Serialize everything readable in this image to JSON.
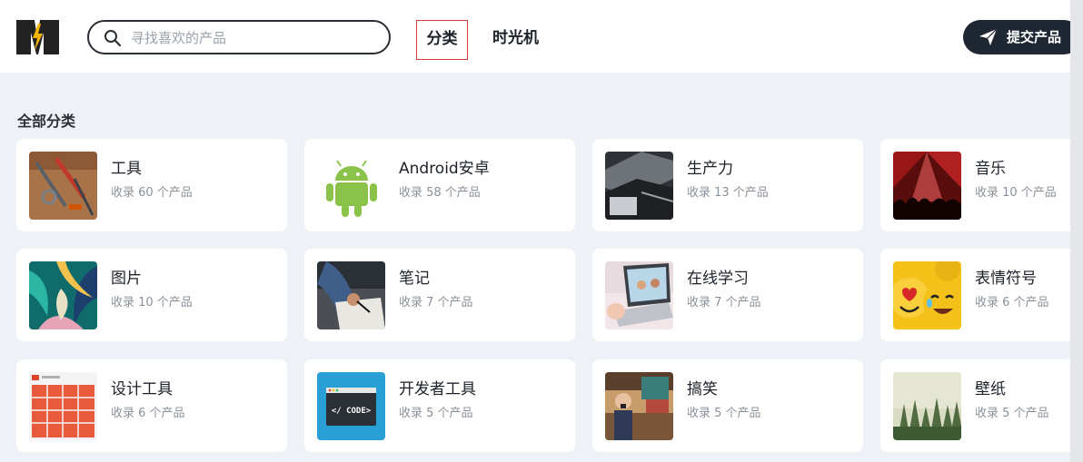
{
  "header": {
    "search_placeholder": "寻找喜欢的产品",
    "nav": [
      {
        "label": "分类"
      },
      {
        "label": "时光机"
      }
    ],
    "submit_label": "提交产品"
  },
  "section": {
    "title": "全部分类"
  },
  "categories": [
    {
      "name": "工具",
      "count": "收录 60 个产品"
    },
    {
      "name": "Android安卓",
      "count": "收录 58 个产品"
    },
    {
      "name": "生产力",
      "count": "收录 13 个产品"
    },
    {
      "name": "音乐",
      "count": "收录 10 个产品"
    },
    {
      "name": "图片",
      "count": "收录 10 个产品"
    },
    {
      "name": "笔记",
      "count": "收录 7 个产品"
    },
    {
      "name": "在线学习",
      "count": "收录 7 个产品"
    },
    {
      "name": "表情符号",
      "count": "收录 6 个产品"
    },
    {
      "name": "设计工具",
      "count": "收录 6 个产品"
    },
    {
      "name": "开发者工具",
      "count": "收录 5 个产品"
    },
    {
      "name": "搞笑",
      "count": "收录 5 个产品"
    },
    {
      "name": "壁纸",
      "count": "收录 5 个产品"
    }
  ],
  "thumb_texts": {
    "code_label": "</ CODE>"
  }
}
